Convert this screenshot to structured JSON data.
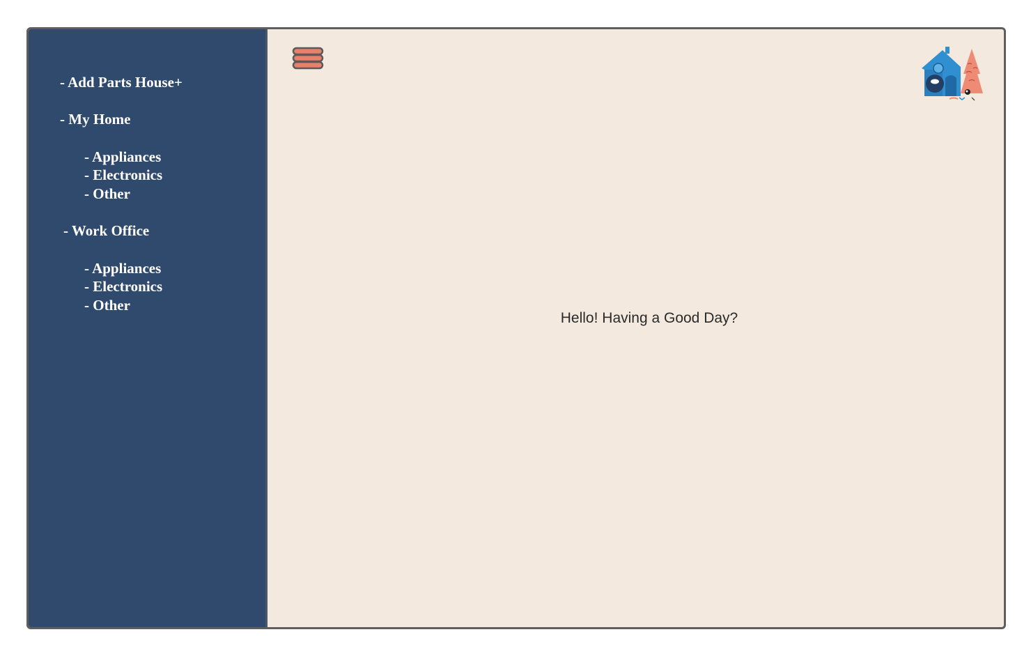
{
  "sidebar": {
    "add_house": "- Add Parts House+",
    "groups": [
      {
        "label": "- My Home",
        "items": [
          "- Appliances",
          "- Electronics",
          "- Other"
        ]
      },
      {
        "label": "- Work Office",
        "items": [
          "- Appliances",
          "- Electronics",
          "- Other"
        ]
      }
    ]
  },
  "header": {
    "menu_icon": "hamburger-menu-icon",
    "logo_icon": "house-tree-logo-icon"
  },
  "main": {
    "greeting": "Hello! Having a Good Day?"
  },
  "colors": {
    "sidebar_bg": "#2f4a6c",
    "main_bg": "#f3e9de",
    "menu_accent": "#e8806a",
    "logo_blue": "#2f8fd0",
    "logo_tree": "#ef8a75"
  }
}
